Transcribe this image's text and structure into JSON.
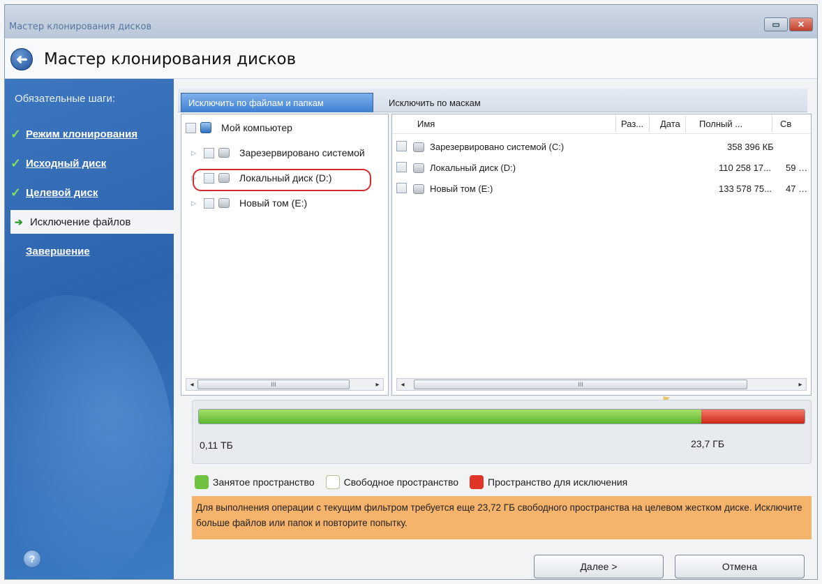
{
  "window": {
    "caption": "Мастер клонирования дисков",
    "minimize_glyph": "▭",
    "close_glyph": "✕"
  },
  "header": {
    "title": "Мастер клонирования дисков",
    "back_glyph": "➜"
  },
  "sidebar": {
    "steps_title": "Обязательные шаги:",
    "steps": [
      {
        "label": "Режим клонирования",
        "mark": "✓",
        "status": "done"
      },
      {
        "label": "Исходный диск",
        "mark": "✓",
        "status": "done"
      },
      {
        "label": "Целевой диск",
        "mark": "✓",
        "status": "done"
      },
      {
        "label": "Исключение файлов",
        "mark": "➔",
        "status": "current"
      },
      {
        "label": "Завершение",
        "mark": "",
        "status": "pending"
      }
    ],
    "help_glyph": "?"
  },
  "tabs": [
    {
      "label": "Исключить по файлам и папкам",
      "active": true
    },
    {
      "label": "Исключить по маскам",
      "active": false
    }
  ],
  "tree": {
    "root": "Мой компьютер",
    "items": [
      "Зарезервировано системой",
      "Локальный диск (D:)",
      "Новый том (E:)"
    ]
  },
  "list": {
    "columns": [
      "Имя",
      "Раз...",
      "Дата",
      "Полный ...",
      "Св"
    ],
    "rows": [
      {
        "name": "Зарезервировано системой (C:)",
        "full": "358 396 КБ",
        "free": ""
      },
      {
        "name": "Локальный диск (D:)",
        "full": "110 258 17...",
        "free": "59 …"
      },
      {
        "name": "Новый том (E:)",
        "full": "133 578 75...",
        "free": "47 …"
      }
    ]
  },
  "scrollbar_thumb": "III",
  "scroll_left": "◂",
  "scroll_right": "▸",
  "capacity": {
    "used_fraction": 0.83,
    "exclude_fraction": 0.17,
    "left_label": "0,11 ТБ",
    "right_label": "23,7 ГБ"
  },
  "legend": [
    {
      "label": "Занятое пространство",
      "color": "#6fc23f"
    },
    {
      "label": "Свободное пространство",
      "color": "#ffffff"
    },
    {
      "label": "Пространство для исключения",
      "color": "#e0362a"
    }
  ],
  "warning": {
    "text": "Для выполнения операции с текущим фильтром требуется еще 23,72 ГБ свободного пространства на целевом жестком диске. Исключите больше файлов или папок и повторите попытку."
  },
  "buttons": {
    "next": "Далее >",
    "cancel": "Отмена"
  }
}
